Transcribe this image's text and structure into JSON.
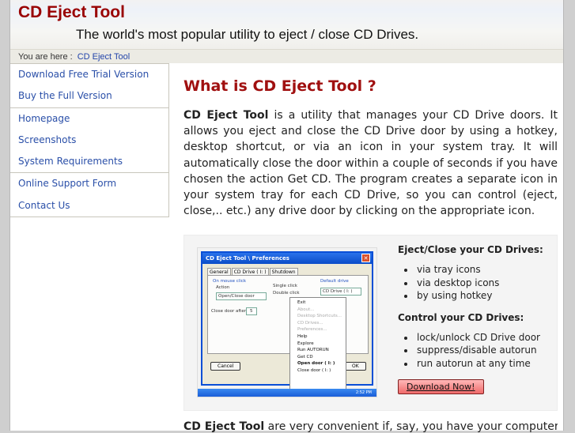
{
  "header": {
    "title": "CD Eject Tool",
    "tagline": "The world's most popular utility to eject / close CD Drives."
  },
  "breadcrumb": {
    "label": "You are here :",
    "current": "CD Eject Tool"
  },
  "sidebar": {
    "groups": [
      {
        "items": [
          "Download Free Trial Version",
          "Buy the Full Version"
        ]
      },
      {
        "items": [
          "Homepage",
          "Screenshots",
          "System Requirements"
        ]
      },
      {
        "items": [
          "Online Support Form",
          "Contact Us"
        ]
      }
    ]
  },
  "main": {
    "heading": "What is CD Eject Tool ?",
    "intro_bold": "CD Eject Tool",
    "intro_text": " is a utility that manages your CD Drive doors. It allows you eject and close the CD Drive door by using a hotkey, desktop shortcut, or via an icon in your system tray. It will automatically close the door within a couple of seconds if you have chosen the action Get CD. The program creates a separate icon in your system tray for each CD Drive, so you can control (eject, close,.. etc.) any drive door by clicking on the appropriate icon.",
    "para2_bold": "CD Eject Tool",
    "para2_text": " are very convenient if, say, you have your computer under"
  },
  "feature": {
    "eject_heading": "Eject/Close your CD Drives:",
    "eject_items": [
      "via tray icons",
      "via desktop icons",
      "by using hotkey"
    ],
    "control_heading": "Control your CD Drives:",
    "control_items": [
      "lock/unlock CD Drive door",
      "suppress/disable autorun",
      "run autorun at any time"
    ],
    "download_label": "Download Now!"
  },
  "screenshot": {
    "title": "CD Eject Tool \\ Preferences",
    "tabs": [
      "General",
      "CD Drive ( I: )",
      "Shutdown"
    ],
    "on_mouse_click": "On mouse click",
    "action": "Action",
    "action_value": "Open/Close door",
    "single": "Single click",
    "double": "Double click",
    "default_drive": "Default drive",
    "drive_value": "CD Drive ( I: )",
    "close_after": "Close door after",
    "seconds": "5",
    "cancel": "Cancel",
    "ok": "OK",
    "menu": [
      "Exit",
      "About...",
      "Desktop Shortcuts...",
      "CD Drives...",
      "Preferences...",
      "Help",
      "Explore",
      "Run AUTORUN",
      "Get CD",
      "Open door ( I: )",
      "Close door ( I: )"
    ],
    "clock": "2:52 PM"
  }
}
